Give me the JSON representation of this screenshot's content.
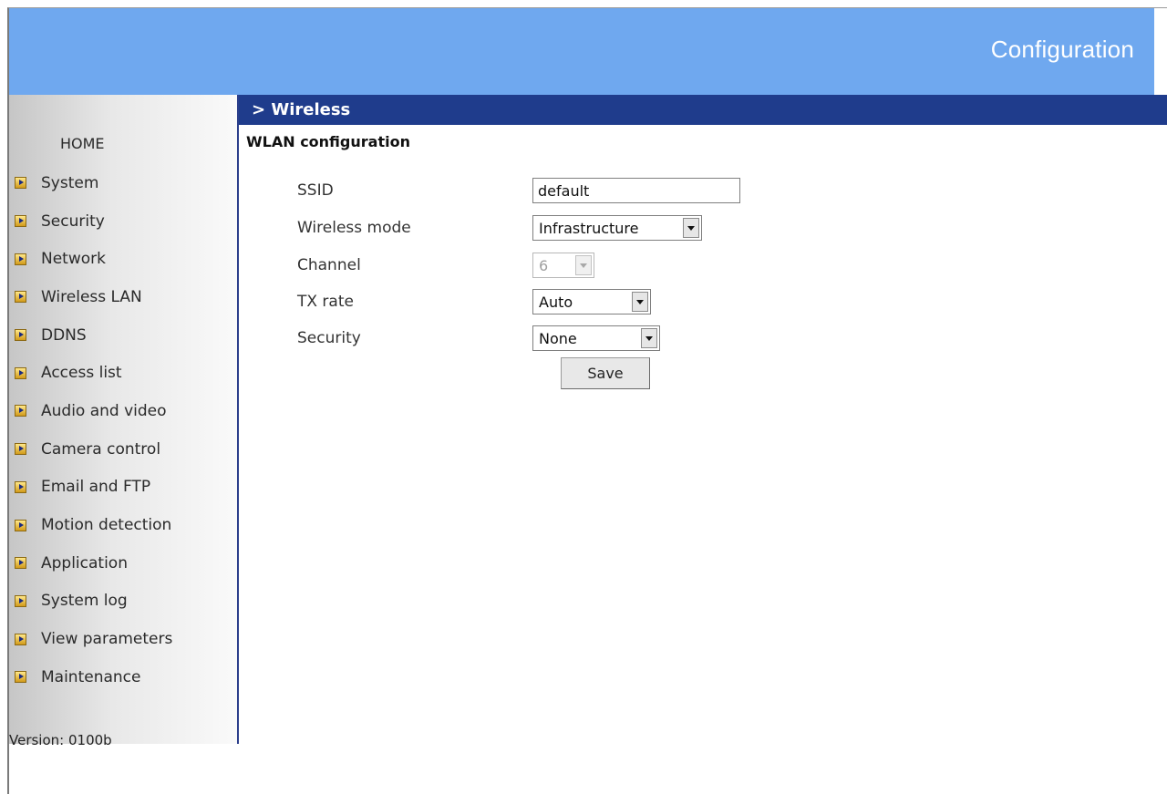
{
  "header": {
    "title": "Configuration"
  },
  "sidebar": {
    "home_label": "HOME",
    "items": [
      {
        "label": "System"
      },
      {
        "label": "Security"
      },
      {
        "label": "Network"
      },
      {
        "label": "Wireless LAN"
      },
      {
        "label": "DDNS"
      },
      {
        "label": "Access list"
      },
      {
        "label": "Audio and video"
      },
      {
        "label": "Camera control"
      },
      {
        "label": "Email and FTP"
      },
      {
        "label": "Motion detection"
      },
      {
        "label": "Application"
      },
      {
        "label": "System log"
      },
      {
        "label": "View parameters"
      },
      {
        "label": "Maintenance"
      }
    ],
    "version_text": "Version: 0100b",
    "arrow_icon": "orange-arrow-icon"
  },
  "main": {
    "section_label": "> Wireless",
    "section_title": "WLAN configuration",
    "form": {
      "ssid": {
        "label": "SSID",
        "value": "default"
      },
      "wireless_mode": {
        "label": "Wireless mode",
        "value": "Infrastructure"
      },
      "channel": {
        "label": "Channel",
        "value": "6",
        "disabled": true
      },
      "tx_rate": {
        "label": "TX rate",
        "value": "Auto"
      },
      "security": {
        "label": "Security",
        "value": "None"
      }
    },
    "save_label": "Save"
  },
  "colors": {
    "header_bg": "#6fa8ef",
    "section_bar_bg": "#1f3c8c",
    "sidebar_border": "#2c3f8c"
  }
}
